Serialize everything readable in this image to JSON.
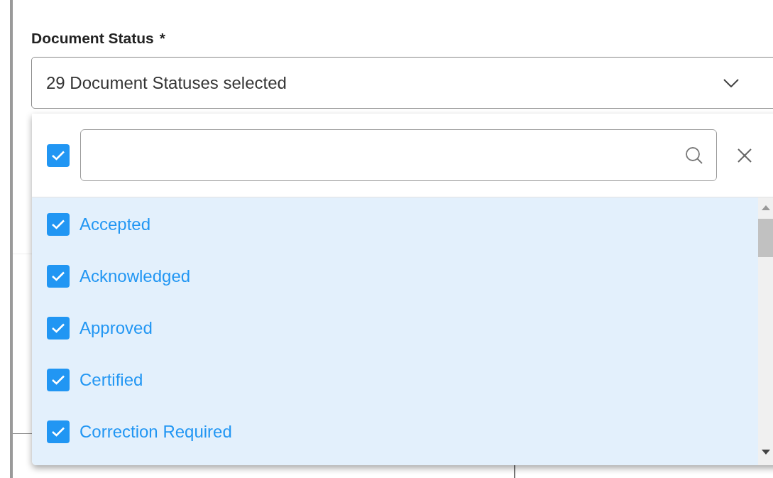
{
  "field": {
    "label": "Document Status",
    "required_mark": "*",
    "value": "29 Document Statuses selected"
  },
  "dropdown": {
    "select_all_checked": true,
    "items": [
      {
        "label": "Accepted",
        "checked": true
      },
      {
        "label": "Acknowledged",
        "checked": true
      },
      {
        "label": "Approved",
        "checked": true
      },
      {
        "label": "Certified",
        "checked": true
      },
      {
        "label": "Correction Required",
        "checked": true
      }
    ]
  }
}
